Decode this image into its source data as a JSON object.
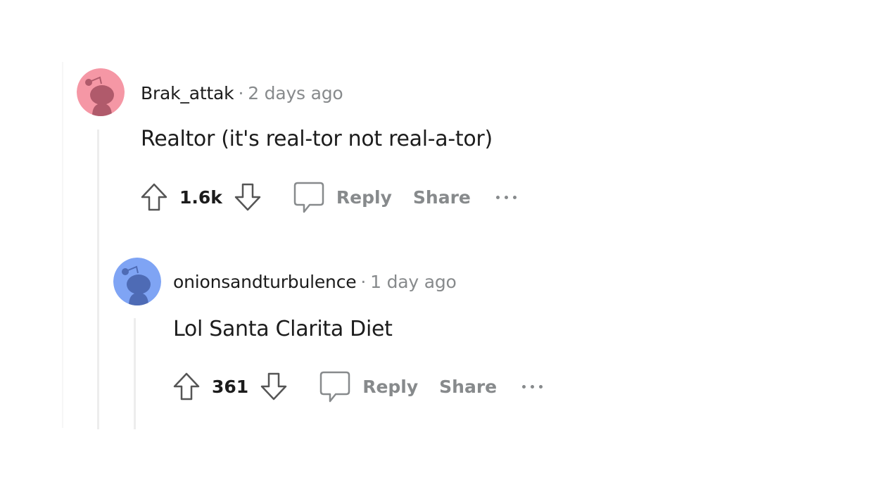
{
  "comments": [
    {
      "username": "Brak_attak",
      "separator": "·",
      "timestamp": "2 days ago",
      "body": "Realtor (it's real-tor not real-a-tor)",
      "score": "1.6k",
      "reply_label": "Reply",
      "share_label": "Share",
      "avatar_color": "#f597a5",
      "avatar_fg": "#b05a6b",
      "avatar_icon": "snoo-avatar-icon"
    },
    {
      "username": "onionsandturbulence",
      "separator": "·",
      "timestamp": "1 day ago",
      "body": "Lol Santa Clarita Diet",
      "score": "361",
      "reply_label": "Reply",
      "share_label": "Share",
      "avatar_color": "#7fa4f4",
      "avatar_fg": "#4e6bb5",
      "avatar_icon": "snoo-avatar-icon"
    }
  ],
  "icons": {
    "upvote": "upvote-arrow-icon",
    "downvote": "downvote-arrow-icon",
    "reply": "speech-bubble-icon",
    "more": "ellipsis-icon"
  }
}
